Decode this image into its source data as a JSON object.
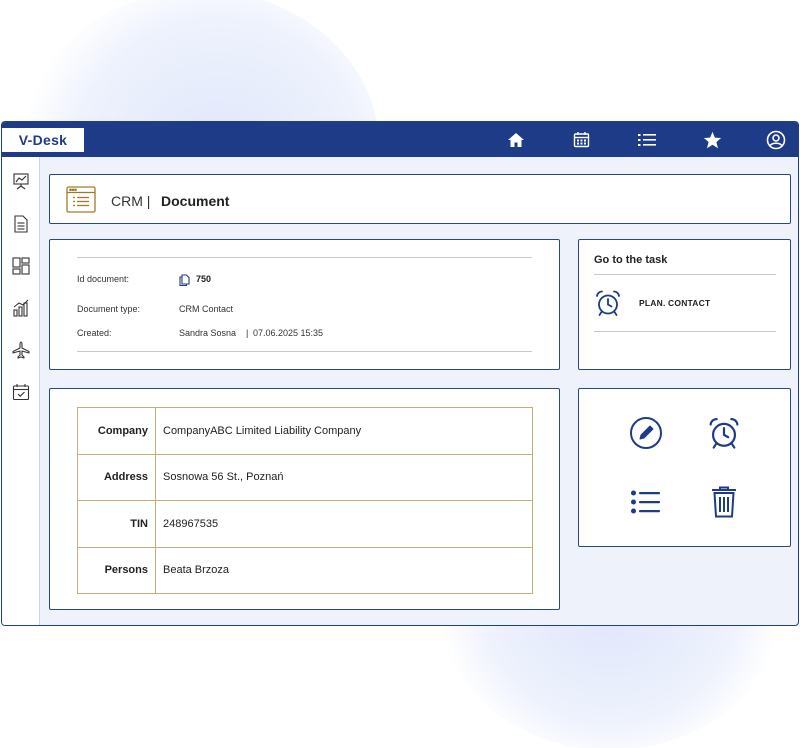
{
  "app": {
    "logo": "V-Desk"
  },
  "topbar": {
    "icons": [
      "home-icon",
      "calendar-icon",
      "list-icon",
      "star-icon",
      "user-profile-icon"
    ]
  },
  "sidebar": {
    "icons": [
      "analytics-board-icon",
      "document-icon",
      "dashboard-icon",
      "bar-chart-icon",
      "airplane-icon",
      "calendar-check-icon"
    ]
  },
  "header": {
    "prefix": "CRM |",
    "title": "Document"
  },
  "document_info": {
    "id_label": "Id document:",
    "id_value": "750",
    "type_label": "Document type:",
    "type_value": "CRM Contact",
    "created_label": "Created:",
    "created_by": "Sandra Sosna",
    "separator": "|",
    "created_date": "07.06.2025 15:35"
  },
  "task_panel": {
    "title": "Go to the task",
    "task_label": "PLAN. CONTACT"
  },
  "details": [
    {
      "label": "Company",
      "value": "CompanyABC Limited Liability Company"
    },
    {
      "label": "Address",
      "value": "Sosnowa 56 St., Poznań"
    },
    {
      "label": "TIN",
      "value": "248967535"
    },
    {
      "label": "Persons",
      "value": "Beata Brzoza"
    }
  ],
  "actions": [
    "edit-icon",
    "alarm-clock-icon",
    "list-icon",
    "trash-icon"
  ],
  "colors": {
    "primary": "#1d3b86",
    "accent_gold": "#a07a2c",
    "table_border": "#c8ad74",
    "background": "#eef2fb"
  }
}
